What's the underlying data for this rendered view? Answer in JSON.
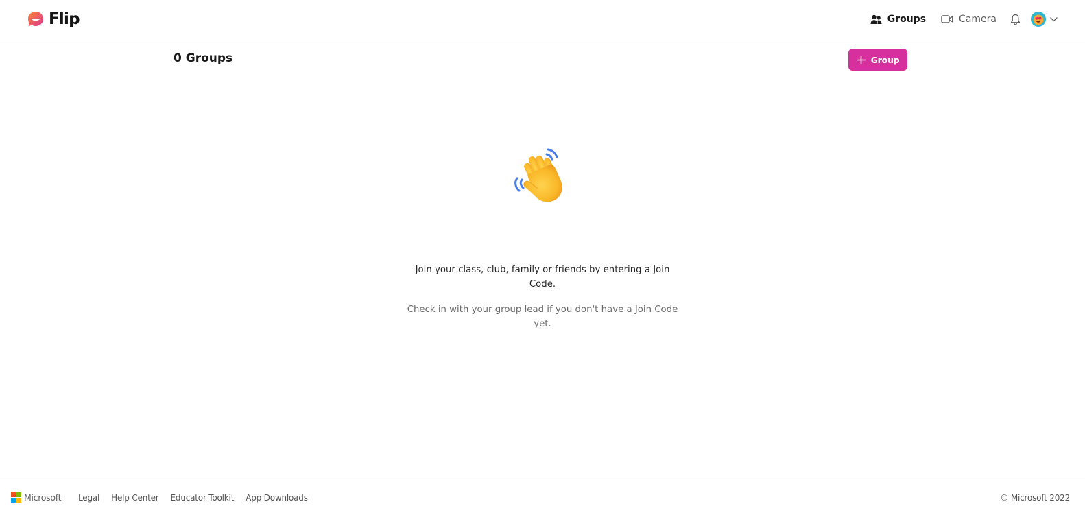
{
  "header": {
    "brand": "Flip",
    "nav": {
      "groups_label": "Groups",
      "camera_label": "Camera"
    }
  },
  "main": {
    "title": "0 Groups",
    "add_group_label": "Group",
    "empty_state": {
      "primary": "Join your class, club, family or friends by entering a Join Code.",
      "secondary": "Check in with your group lead if you don't have a Join Code yet."
    }
  },
  "footer": {
    "brand": "Microsoft",
    "links": [
      "Legal",
      "Help Center",
      "Educator Toolkit",
      "App Downloads"
    ],
    "copyright": "© Microsoft 2022"
  },
  "colors": {
    "accent": "#d6309e",
    "avatar_bg": "#2ab8d6"
  },
  "icons": {
    "logo": "flip-logo-icon",
    "groups": "groups-icon",
    "camera": "camera-icon",
    "notifications": "bell-icon",
    "avatar": "avatar-icon",
    "menu": "chevron-down-icon",
    "add": "plus-icon",
    "empty_state": "waving-hand-icon",
    "microsoft": "microsoft-logo-icon"
  }
}
